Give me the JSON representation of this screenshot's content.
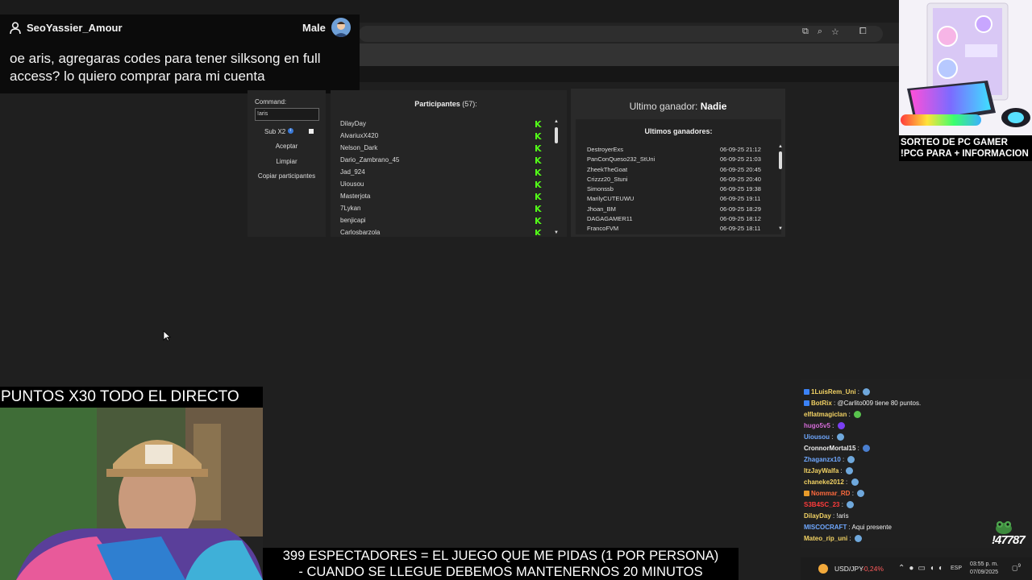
{
  "chat_overlay": {
    "username": "SeoYassier_Amour",
    "gender": "Male",
    "message": "oe aris, agregaras codes para tener silksong en full access? lo quiero comprar para mi cuenta"
  },
  "giveaway": {
    "command_label": "Command:",
    "command_value": "!aris",
    "sub_label": "Sub X2",
    "buttons": [
      "Aceptar",
      "Limpiar",
      "Copiar participantes"
    ],
    "participants_label": "Participantes",
    "participants_count": "(57):",
    "participants": [
      "DilayDay",
      "AlvariuxX420",
      "Nelson_Dark",
      "Dario_Zambrano_45",
      "Jad_924",
      "Uiousou",
      "Masterjota",
      "7Lykan",
      "benjicapi",
      "Carlosbarzola"
    ],
    "winner_label": "Ultimo ganador:",
    "winner_value": "Nadie",
    "recent_label": "Ultimos ganadores:",
    "recent_winners": [
      {
        "name": "DestroyerExs",
        "date": "06-09-25 21:12"
      },
      {
        "name": "PanConQueso232_StUni",
        "date": "06-09-25 21:03"
      },
      {
        "name": "ZheekTheGoat",
        "date": "06-09-25 20:45"
      },
      {
        "name": "Crizzz20_Stuni",
        "date": "06-09-25 20:40"
      },
      {
        "name": "Simonssb",
        "date": "06-09-25 19:38"
      },
      {
        "name": "MarilyCUTEUWU",
        "date": "06-09-25 19:11"
      },
      {
        "name": "Jhoan_BM",
        "date": "06-09-25 18:29"
      },
      {
        "name": "DAGAGAMER11",
        "date": "06-09-25 18:12"
      },
      {
        "name": "FrancoFVM",
        "date": "06-09-25 18:11"
      }
    ]
  },
  "promo": {
    "text": "SORTEO DE PC GAMER !PCG PARA + INFORMACION"
  },
  "webcam": {
    "banner": "PUNTOS X30 TODO EL DIRECTO"
  },
  "chat": {
    "lines": [
      {
        "user": "1LuisRem_Uni",
        "text": " : ",
        "color": "#f2d264",
        "badge": "#3b82f6",
        "emote": "#6fa8dc"
      },
      {
        "user": "BotRix",
        "text": " : @Carlito009 tiene 80 puntos.",
        "color": "#f2d264",
        "badge": "#3b82f6",
        "emote": ""
      },
      {
        "user": "elflatmagiclan",
        "text": " : ",
        "color": "#f2d264",
        "badge": "",
        "emote": "#58c24d"
      },
      {
        "user": "hugo5v5",
        "text": " : ",
        "color": "#d36bd6",
        "badge": "",
        "emote": "#7a3ff2"
      },
      {
        "user": "Uiousou",
        "text": " : ",
        "color": "#6fa8ff",
        "badge": "",
        "emote": "#6fa8dc"
      },
      {
        "user": "CronnorMortal15",
        "text": " : ",
        "color": "#f0f0f0",
        "badge": "",
        "emote": "#4a7fd0"
      },
      {
        "user": "Zhaganzx10",
        "text": " : ",
        "color": "#6fa8ff",
        "badge": "",
        "emote": "#6fa8dc"
      },
      {
        "user": "ItzJayWalfa",
        "text": " : ",
        "color": "#f2d264",
        "badge": "",
        "emote": "#6fa8dc"
      },
      {
        "user": "chaneke2012",
        "text": " : ",
        "color": "#f2d264",
        "badge": "",
        "emote": "#6fa8dc"
      },
      {
        "user": "Nommar_RD",
        "text": " : ",
        "color": "#ff6a3d",
        "badge": "#e89b2a",
        "emote": "#6fa8dc"
      },
      {
        "user": "S3B4SC_23",
        "text": " : ",
        "color": "#ff3b3b",
        "badge": "",
        "emote": "#6fa8dc"
      },
      {
        "user": "DilayDay",
        "text": " : !aris",
        "color": "#f2d264",
        "badge": "",
        "emote": ""
      },
      {
        "user": "MISCOCRAFT",
        "text": " : Aqui presente",
        "color": "#6fa8ff",
        "badge": "",
        "emote": ""
      },
      {
        "user": "Mateo_rip_uni",
        "text": " : ",
        "color": "#f2d264",
        "badge": "",
        "emote": "#6fa8dc"
      }
    ],
    "viewer_overlay": "!47787"
  },
  "bottom_banner": {
    "line1": "399 ESPECTADORES = EL JUEGO QUE ME PIDAS (1 POR PERSONA)",
    "line2": "- CUANDO SE LLEGUE DEBEMOS MANTENERNOS 20 MINUTOS"
  },
  "taskbar": {
    "ticker": "USD/JPY",
    "change": "-0,24%",
    "lang": "ESP",
    "time": "03:55 p. m.",
    "date": "07/09/2025",
    "notifications": "9"
  }
}
